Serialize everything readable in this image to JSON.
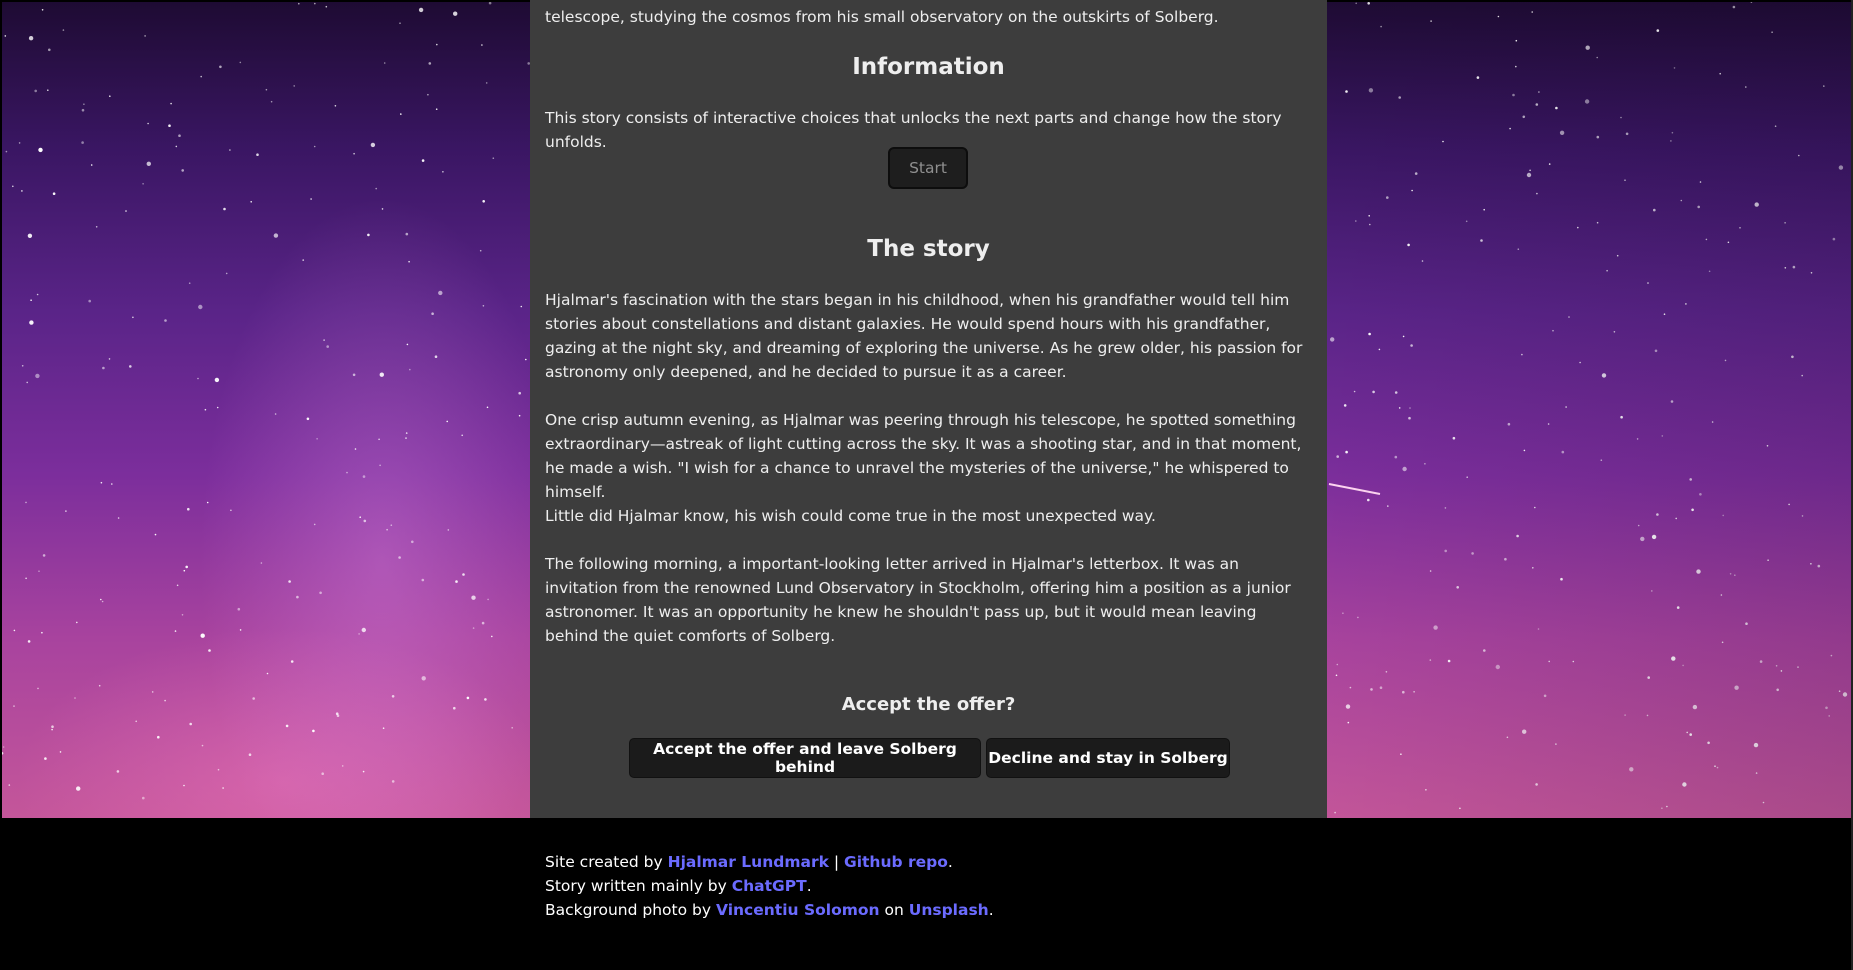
{
  "intro_tail": "telescope, studying the cosmos from his small observatory on the outskirts of Solberg.",
  "information": {
    "title": "Information",
    "text": "This story consists of interactive choices that unlocks the next parts and change how the story unfolds.",
    "start_label": "Start"
  },
  "story": {
    "title": "The story",
    "paragraphs": [
      "Hjalmar's fascination with the stars began in his childhood, when his grandfather would tell him stories about constellations and distant galaxies. He would spend hours with his grandfather, gazing at the night sky, and dreaming of exploring the universe. As he grew older, his passion for astronomy only deepened, and he decided to pursue it as a career.",
      "One crisp autumn evening, as Hjalmar was peering through his telescope, he spotted something extraordinary—astreak of light cutting across the sky. It was a shooting star, and in that moment, he made a wish. \"I wish for a chance to unravel the mysteries of the universe,\" he whispered to himself.",
      "Little did Hjalmar know, his wish could come true in the most unexpected way.",
      "The following morning, a important-looking letter arrived in Hjalmar's letterbox. It was an invitation from the renowned Lund Observatory in Stockholm, offering him a position as a junior astronomer. It was an opportunity he knew he shouldn't pass up, but it would mean leaving behind the quiet comforts of Solberg."
    ]
  },
  "choice": {
    "question": "Accept the offer?",
    "accept_label": "Accept the offer and leave Solberg behind",
    "decline_label": "Decline and stay in Solberg"
  },
  "footer": {
    "line1_prefix": "Site created by ",
    "author_link": "Hjalmar Lundmark",
    "separator": " | ",
    "repo_link": "Github repo",
    "line1_suffix": ".",
    "line2_prefix": "Story written mainly by ",
    "chatgpt_link": "ChatGPT",
    "line2_suffix": ".",
    "line3_prefix": "Background photo by ",
    "photographer_link": "Vincentiu Solomon",
    "line3_middle": " on ",
    "unsplash_link": "Unsplash",
    "line3_suffix": "."
  },
  "colors": {
    "content_bg": "#3d3d3d",
    "button_bg": "#1b1b1b",
    "link": "#6b6bff"
  }
}
